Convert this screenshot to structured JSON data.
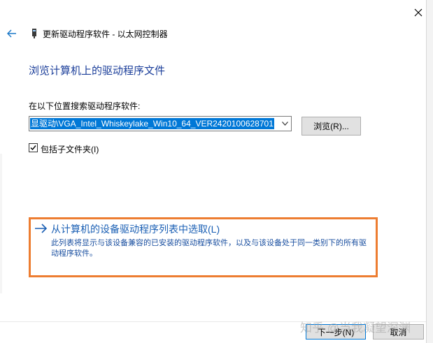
{
  "window": {
    "title": "更新驱动程序软件 - 以太网控制器"
  },
  "page": {
    "heading": "浏览计算机上的驱动程序文件",
    "search_label": "在以下位置搜索驱动程序软件:",
    "path_value": "显驱动\\VGA_Intel_Whiskeylake_Win10_64_VER2420100628701",
    "browse_label": "浏览(R)...",
    "include_subfolders_label": "包括子文件夹(I)",
    "include_subfolders_checked": true
  },
  "option": {
    "title": "从计算机的设备驱动程序列表中选取(L)",
    "description": "此列表将显示与该设备兼容的已安装的驱动程序软件，以及与该设备处于同一类别下的所有驱动程序软件。"
  },
  "footer": {
    "next_label": "下一步(N)",
    "cancel_label": "取消"
  },
  "watermark": "知乎 @当我凝望深渊",
  "colors": {
    "heading": "#1b3e9a",
    "link": "#1a5fb4",
    "highlight_box": "#ed7d31",
    "selection": "#0078d7"
  }
}
